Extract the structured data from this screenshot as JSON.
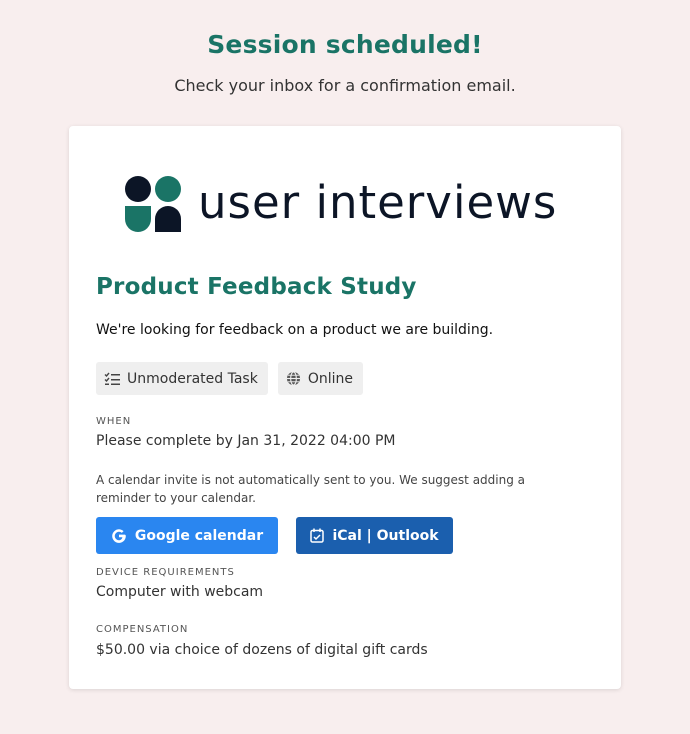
{
  "header": {
    "title": "Session scheduled!",
    "subtitle": "Check your inbox for a confirmation email."
  },
  "logo": {
    "text": "user interviews"
  },
  "study": {
    "title": "Product Feedback Study",
    "description": "We're looking for feedback on a product we are building.",
    "tags": [
      {
        "label": "Unmoderated Task",
        "icon": "checklist-icon"
      },
      {
        "label": "Online",
        "icon": "globe-icon"
      }
    ]
  },
  "when": {
    "label": "WHEN",
    "value": "Please complete by Jan 31, 2022 04:00 PM"
  },
  "calendar_note": "A calendar invite is not automatically sent to you. We suggest adding a reminder to your calendar.",
  "buttons": {
    "google": "Google calendar",
    "ical": "iCal | Outlook"
  },
  "device": {
    "label": "DEVICE REQUIREMENTS",
    "value": "Computer with webcam"
  },
  "compensation": {
    "label": "COMPENSATION",
    "value": "$50.00 via choice of dozens of digital gift cards"
  },
  "colors": {
    "background": "#f8eeee",
    "brand_green": "#1a7466",
    "google_blue": "#2a86f0",
    "ical_blue": "#1b5fae",
    "logo_navy": "#0c1526"
  }
}
